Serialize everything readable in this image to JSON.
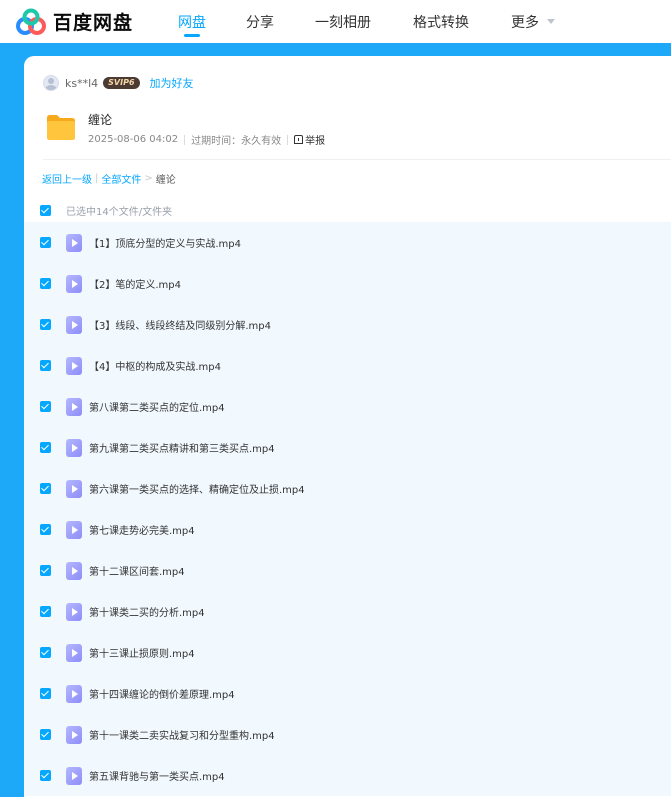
{
  "header": {
    "logo_text": "百度网盘",
    "nav": [
      {
        "label": "网盘",
        "active": true
      },
      {
        "label": "分享",
        "active": false
      },
      {
        "label": "一刻相册",
        "active": false
      },
      {
        "label": "格式转换",
        "active": false
      },
      {
        "label": "更多",
        "active": false
      }
    ]
  },
  "sharer": {
    "name": "ks**l4",
    "badge": "SVIP6",
    "add_friend": "加为好友"
  },
  "folder": {
    "title": "缠论",
    "date": "2025-08-06 04:02",
    "expire": "过期时间：永久有效",
    "report": "举报"
  },
  "breadcrumb": {
    "back": "返回上一级",
    "all_files": "全部文件",
    "separator": ">",
    "current": "缠论",
    "divider": "|"
  },
  "selection": {
    "text": "已选中14个文件/文件夹"
  },
  "files": [
    "【1】顶底分型的定义与实战.mp4",
    "【2】笔的定义.mp4",
    "【3】线段、线段终结及同级别分解.mp4",
    "【4】中枢的构成及实战.mp4",
    "第八课第二类买点的定位.mp4",
    "第九课第二类买点精讲和第三类买点.mp4",
    "第六课第一类买点的选择、精确定位及止损.mp4",
    "第七课走势必完美.mp4",
    "第十二课区间套.mp4",
    "第十课类二买的分析.mp4",
    "第十三课止损原则.mp4",
    "第十四课缠论的倒价差原理.mp4",
    "第十一课类二卖实战复习和分型重构.mp4",
    "第五课背驰与第一类买点.mp4"
  ],
  "colors": {
    "brand_blue": "#06a7ff",
    "page_bg": "#1ea8f8",
    "row_bg": "#f1f8fe",
    "folder_yellow": "#ffc53d",
    "video_icon": "#8e8cf7"
  },
  "icons": {
    "logo": "baidu-netdisk-logo",
    "folder": "folder-icon",
    "file": "video-file-icon",
    "checkbox": "checkbox-checked-icon",
    "report": "report-icon"
  }
}
